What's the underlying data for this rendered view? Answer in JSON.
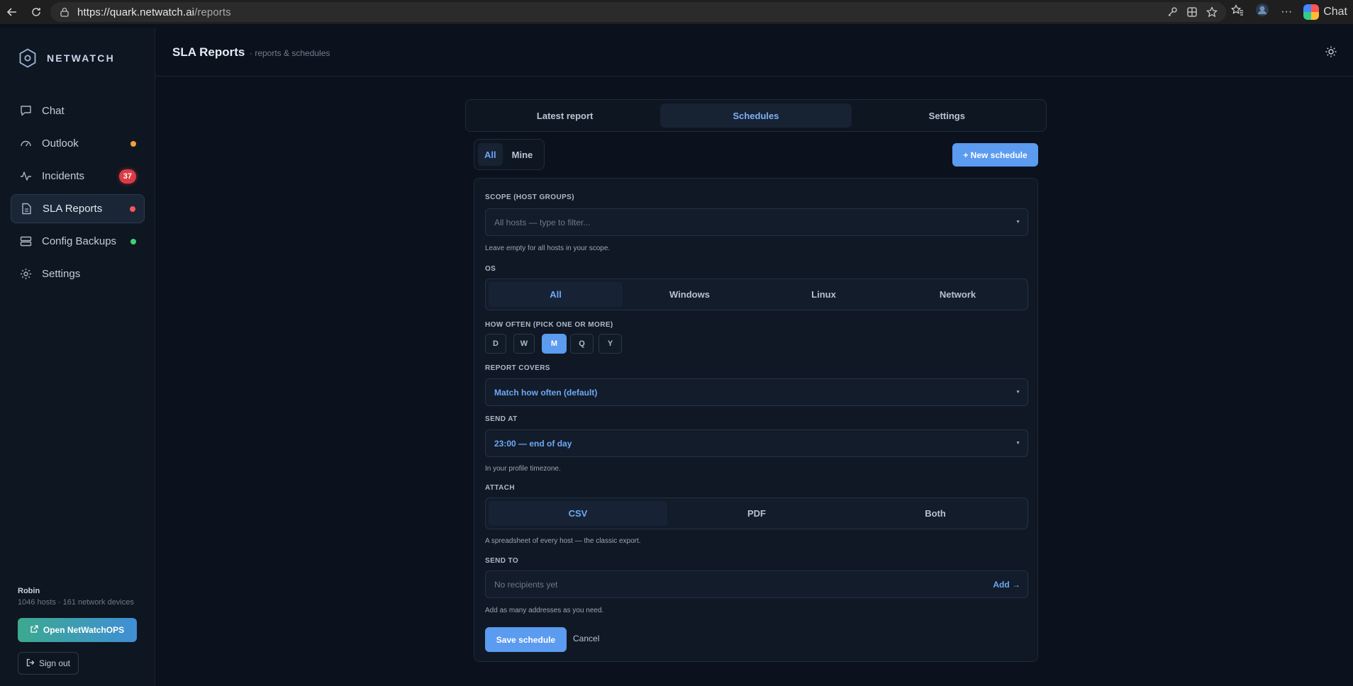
{
  "browser": {
    "url_host": "https://quark.netwatch.ai",
    "url_path": "/reports",
    "copilot_label": "Chat"
  },
  "brand": {
    "name": "NETWATCH"
  },
  "sidebar": {
    "items": [
      {
        "label": "Chat",
        "icon": "chat-icon"
      },
      {
        "label": "Outlook",
        "icon": "gauge-icon",
        "dot_color": "#f2a03a"
      },
      {
        "label": "Incidents",
        "icon": "pulse-icon",
        "badge": "37"
      },
      {
        "label": "SLA Reports",
        "icon": "document-icon",
        "dot_color": "#ef5a5a",
        "active": true
      },
      {
        "label": "Config Backups",
        "icon": "server-icon",
        "dot_color": "#3fcf76"
      },
      {
        "label": "Settings",
        "icon": "gear-icon"
      }
    ],
    "user_name": "Robin",
    "user_meta": "1046 hosts · 161 network devices",
    "open_ops_label": "Open NetWatchOPS",
    "signout_label": "Sign out"
  },
  "header": {
    "title": "SLA Reports",
    "subtitle": "· reports & schedules"
  },
  "tabs": [
    {
      "label": "Latest report"
    },
    {
      "label": "Schedules",
      "active": true
    },
    {
      "label": "Settings"
    }
  ],
  "filter": {
    "all": "All",
    "mine": "Mine"
  },
  "new_schedule_label": "+ New schedule",
  "form": {
    "scope_label": "SCOPE (HOST GROUPS)",
    "scope_placeholder": "All hosts — type to filter...",
    "scope_help": "Leave empty for all hosts in your scope.",
    "os_label": "OS",
    "os_options": [
      "All",
      "Windows",
      "Linux",
      "Network"
    ],
    "os_selected": "All",
    "freq_label": "HOW OFTEN (PICK ONE OR MORE)",
    "freq_options": [
      "D",
      "W",
      "M",
      "Q",
      "Y"
    ],
    "freq_selected": "M",
    "covers_label": "REPORT COVERS",
    "covers_value": "Match how often (default)",
    "send_at_label": "SEND AT",
    "send_at_value": "23:00 — end of day",
    "send_at_help": "In your profile timezone.",
    "attach_label": "ATTACH",
    "attach_options": [
      "CSV",
      "PDF",
      "Both"
    ],
    "attach_selected": "CSV",
    "attach_help": "A spreadsheet of every host — the classic export.",
    "send_to_label": "SEND TO",
    "send_to_placeholder": "No recipients yet",
    "add_label": "Add →",
    "send_to_help": "Add as many addresses as you need.",
    "save_label": "Save schedule",
    "cancel_label": "Cancel"
  },
  "colors": {
    "accent": "#5b9bf0",
    "background": "#0b121d",
    "badge": "#dc3b45"
  }
}
